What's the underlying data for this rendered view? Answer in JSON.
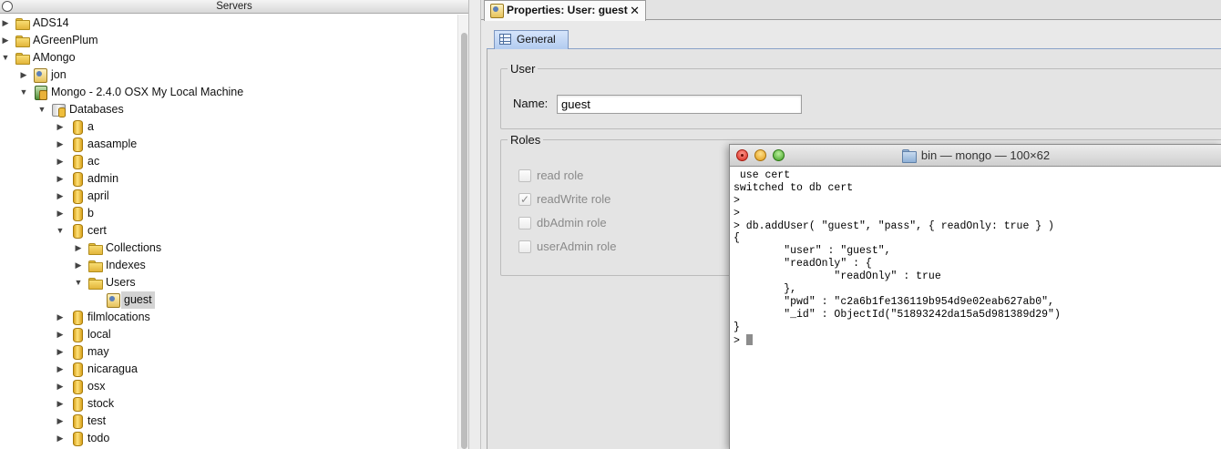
{
  "servers_panel": {
    "title": "Servers",
    "tree": [
      {
        "id": "ads14",
        "label": "ADS14",
        "level": 0,
        "expanded": false,
        "icon": "folder-icon"
      },
      {
        "id": "agreenplum",
        "label": "AGreenPlum",
        "level": 0,
        "expanded": false,
        "icon": "folder-icon"
      },
      {
        "id": "amongo",
        "label": "AMongo",
        "level": 0,
        "expanded": true,
        "icon": "folder-icon"
      },
      {
        "id": "jon",
        "label": "jon",
        "level": 1,
        "expanded": false,
        "icon": "user-icon"
      },
      {
        "id": "mongo-server",
        "label": "Mongo - 2.4.0 OSX My Local Machine",
        "level": 1,
        "expanded": true,
        "icon": "server-icon"
      },
      {
        "id": "databases",
        "label": "Databases",
        "level": 2,
        "expanded": true,
        "icon": "databases-icon"
      },
      {
        "id": "db-a",
        "label": "a",
        "level": 3,
        "expanded": false,
        "icon": "database-icon"
      },
      {
        "id": "db-aasample",
        "label": "aasample",
        "level": 3,
        "expanded": false,
        "icon": "database-icon"
      },
      {
        "id": "db-ac",
        "label": "ac",
        "level": 3,
        "expanded": false,
        "icon": "database-icon"
      },
      {
        "id": "db-admin",
        "label": "admin",
        "level": 3,
        "expanded": false,
        "icon": "database-icon"
      },
      {
        "id": "db-april",
        "label": "april",
        "level": 3,
        "expanded": false,
        "icon": "database-icon"
      },
      {
        "id": "db-b",
        "label": "b",
        "level": 3,
        "expanded": false,
        "icon": "database-icon"
      },
      {
        "id": "db-cert",
        "label": "cert",
        "level": 3,
        "expanded": true,
        "icon": "database-icon"
      },
      {
        "id": "collections",
        "label": "Collections",
        "level": 4,
        "expanded": false,
        "icon": "folder-icon"
      },
      {
        "id": "indexes",
        "label": "Indexes",
        "level": 4,
        "expanded": false,
        "icon": "folder-icon"
      },
      {
        "id": "users",
        "label": "Users",
        "level": 4,
        "expanded": true,
        "icon": "folder-icon"
      },
      {
        "id": "user-guest",
        "label": "guest",
        "level": 5,
        "leaf": true,
        "selected": true,
        "icon": "user-icon"
      },
      {
        "id": "db-filmlocations",
        "label": "filmlocations",
        "level": 3,
        "expanded": false,
        "icon": "database-icon"
      },
      {
        "id": "db-local",
        "label": "local",
        "level": 3,
        "expanded": false,
        "icon": "database-icon"
      },
      {
        "id": "db-may",
        "label": "may",
        "level": 3,
        "expanded": false,
        "icon": "database-icon"
      },
      {
        "id": "db-nicaragua",
        "label": "nicaragua",
        "level": 3,
        "expanded": false,
        "icon": "database-icon"
      },
      {
        "id": "db-osx",
        "label": "osx",
        "level": 3,
        "expanded": false,
        "icon": "database-icon"
      },
      {
        "id": "db-stock",
        "label": "stock",
        "level": 3,
        "expanded": false,
        "icon": "database-icon"
      },
      {
        "id": "db-test",
        "label": "test",
        "level": 3,
        "expanded": false,
        "icon": "database-icon"
      },
      {
        "id": "db-todo",
        "label": "todo",
        "level": 3,
        "expanded": false,
        "icon": "database-icon"
      }
    ]
  },
  "properties": {
    "tab_label": "Properties: User: guest",
    "close_glyph": "✕",
    "general_tab_label": "General",
    "user_group": {
      "legend": "User",
      "name_label": "Name:",
      "name_value": "guest"
    },
    "roles_group": {
      "legend": "Roles",
      "roles": [
        {
          "label": "read role",
          "checked": false
        },
        {
          "label": "readWrite role",
          "checked": true
        },
        {
          "label": "dbAdmin role",
          "checked": false
        },
        {
          "label": "userAdmin role",
          "checked": false
        }
      ]
    }
  },
  "terminal": {
    "title": "bin — mongo — 100×62",
    "lines": [
      " use cert",
      "switched to db cert",
      ">",
      ">",
      "> db.addUser( \"guest\", \"pass\", { readOnly: true } )",
      "{",
      "        \"user\" : \"guest\",",
      "        \"readOnly\" : {",
      "                \"readOnly\" : true",
      "        },",
      "        \"pwd\" : \"c2a6b1fe136119b954d9e02eab627ab0\",",
      "        \"_id\" : ObjectId(\"51893242da15a5d981389d29\")",
      "}"
    ],
    "prompt": "> "
  }
}
